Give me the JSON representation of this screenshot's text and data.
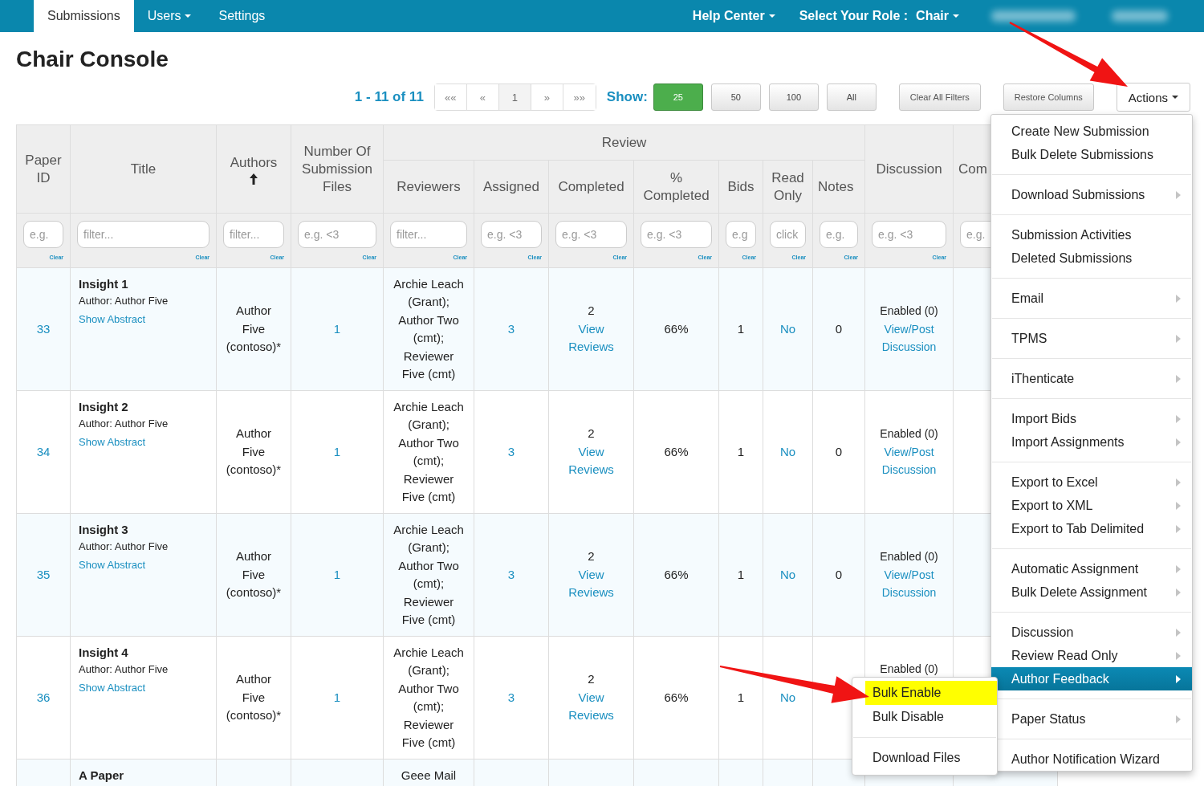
{
  "nav": {
    "tabs": [
      {
        "label": "Submissions",
        "selected": true,
        "dropdown": false
      },
      {
        "label": "Users",
        "selected": false,
        "dropdown": true
      },
      {
        "label": "Settings",
        "selected": false,
        "dropdown": false
      }
    ],
    "help": "Help Center",
    "role_label": "Select Your Role :",
    "role_value": "Chair"
  },
  "page_title": "Chair Console",
  "pager": {
    "summary": "1 - 11 of 11",
    "pages": [
      {
        "label": "««",
        "selected": false
      },
      {
        "label": "«",
        "selected": false
      },
      {
        "label": "1",
        "selected": true
      },
      {
        "label": "»",
        "selected": false
      },
      {
        "label": "»»",
        "selected": false
      }
    ],
    "show_label": "Show:",
    "sizes": [
      {
        "label": "25",
        "selected": true
      },
      {
        "label": "50",
        "selected": false
      },
      {
        "label": "100",
        "selected": false
      },
      {
        "label": "All",
        "selected": false
      }
    ]
  },
  "toolbar_buttons": [
    "Clear All Filters",
    "Restore Columns"
  ],
  "actions_button": "Actions",
  "columns": [
    {
      "label": "Paper ID",
      "placeholder": "e.g.",
      "clear": "Clear"
    },
    {
      "label": "Title",
      "placeholder": "filter...",
      "clear": "Clear"
    },
    {
      "label": "Authors",
      "sorted": true,
      "placeholder": "filter...",
      "clear": "Clear"
    },
    {
      "label": "Number Of Submission Files",
      "placeholder": "e.g. <3",
      "clear": "Clear"
    },
    {
      "kind": "group",
      "label": "Review",
      "columns": [
        {
          "label": "Reviewers",
          "placeholder": "filter...",
          "clear": "Clear"
        },
        {
          "label": "Assigned",
          "placeholder": "e.g. <3",
          "clear": "Clear"
        },
        {
          "label": "Completed",
          "placeholder": "e.g. <3",
          "clear": "Clear"
        },
        {
          "label": "% Completed",
          "placeholder": "e.g. <3",
          "clear": "Clear"
        },
        {
          "label": "Bids",
          "placeholder": "e.g",
          "clear": "Clear"
        },
        {
          "label": "Read Only",
          "placeholder": "click",
          "clear": "Clear"
        },
        {
          "label": "Notes",
          "placeholder": "e.g.",
          "clear": "Clear"
        }
      ]
    },
    {
      "label": "Discussion",
      "placeholder": "e.g. <3",
      "clear": "Clear"
    },
    {
      "label": "Com",
      "placeholder": "e.g."
    }
  ],
  "rows": [
    {
      "paper_id": "33",
      "title": "Insight 1",
      "author_line": "Author: Author Five",
      "abstract_link": "Show Abstract",
      "authors": "Author Five (contoso)*",
      "files": "1",
      "reviewers": "Archie Leach (Grant); Author Two (cmt); Reviewer Five (cmt)",
      "assigned": "3",
      "completed": "2",
      "reviews_link": "View Reviews",
      "percent": "66%",
      "bids": "1",
      "read_only": "No",
      "notes": "0",
      "discussion": "Enabled (0)",
      "discussion_link": "View/Post Discussion"
    },
    {
      "paper_id": "34",
      "title": "Insight 2",
      "author_line": "Author: Author Five",
      "abstract_link": "Show Abstract",
      "authors": "Author Five (contoso)*",
      "files": "1",
      "reviewers": "Archie Leach (Grant); Author Two (cmt); Reviewer Five (cmt)",
      "assigned": "3",
      "completed": "2",
      "reviews_link": "View Reviews",
      "percent": "66%",
      "bids": "1",
      "read_only": "No",
      "notes": "0",
      "discussion": "Enabled (0)",
      "discussion_link": "View/Post Discussion"
    },
    {
      "paper_id": "35",
      "title": "Insight 3",
      "author_line": "Author: Author Five",
      "abstract_link": "Show Abstract",
      "authors": "Author Five (contoso)*",
      "files": "1",
      "reviewers": "Archie Leach (Grant); Author Two (cmt); Reviewer Five (cmt)",
      "assigned": "3",
      "completed": "2",
      "reviews_link": "View Reviews",
      "percent": "66%",
      "bids": "1",
      "read_only": "No",
      "notes": "0",
      "discussion": "Enabled (0)",
      "discussion_link": "View/Post Discussion"
    },
    {
      "paper_id": "36",
      "title": "Insight 4",
      "author_line": "Author: Author Five",
      "abstract_link": "Show Abstract",
      "authors": "Author Five (contoso)*",
      "files": "1",
      "reviewers": "Archie Leach (Grant); Author Two (cmt); Reviewer Five (cmt)",
      "assigned": "3",
      "completed": "2",
      "reviews_link": "View Reviews",
      "percent": "66%",
      "bids": "1",
      "read_only": "No",
      "discussion": "Enabled (0)"
    },
    {
      "title": "A Paper",
      "reviewers": "Geee Mail"
    }
  ],
  "actions_menu": [
    [
      {
        "label": "Create New Submission",
        "submenu": false,
        "selected": false
      },
      {
        "label": "Bulk Delete Submissions",
        "submenu": false,
        "selected": false
      }
    ],
    [
      {
        "label": "Download Submissions",
        "submenu": true,
        "selected": false
      }
    ],
    [
      {
        "label": "Submission Activities",
        "submenu": false,
        "selected": false
      },
      {
        "label": "Deleted Submissions",
        "submenu": false,
        "selected": false
      }
    ],
    [
      {
        "label": "Email",
        "submenu": true,
        "selected": false
      }
    ],
    [
      {
        "label": "TPMS",
        "submenu": true,
        "selected": false
      }
    ],
    [
      {
        "label": "iThenticate",
        "submenu": true,
        "selected": false
      }
    ],
    [
      {
        "label": "Import Bids",
        "submenu": true,
        "selected": false
      },
      {
        "label": "Import Assignments",
        "submenu": true,
        "selected": false
      }
    ],
    [
      {
        "label": "Export to Excel",
        "submenu": true,
        "selected": false
      },
      {
        "label": "Export to XML",
        "submenu": true,
        "selected": false
      },
      {
        "label": "Export to Tab Delimited",
        "submenu": true,
        "selected": false
      }
    ],
    [
      {
        "label": "Automatic Assignment",
        "submenu": true,
        "selected": false
      },
      {
        "label": "Bulk Delete Assignment",
        "submenu": true,
        "selected": false
      }
    ],
    [
      {
        "label": "Discussion",
        "submenu": true,
        "selected": false
      },
      {
        "label": "Review Read Only",
        "submenu": true,
        "selected": false
      },
      {
        "label": "Author Feedback",
        "submenu": true,
        "selected": true,
        "children": [
          [
            {
              "label": "Bulk Enable",
              "selected": true
            },
            {
              "label": "Bulk Disable",
              "selected": false
            }
          ],
          [
            {
              "label": "Download Files",
              "selected": false
            }
          ]
        ]
      }
    ],
    [
      {
        "label": "Paper Status",
        "submenu": true,
        "selected": false
      }
    ],
    [
      {
        "label": "Author Notification Wizard",
        "submenu": false,
        "selected": false
      }
    ]
  ]
}
